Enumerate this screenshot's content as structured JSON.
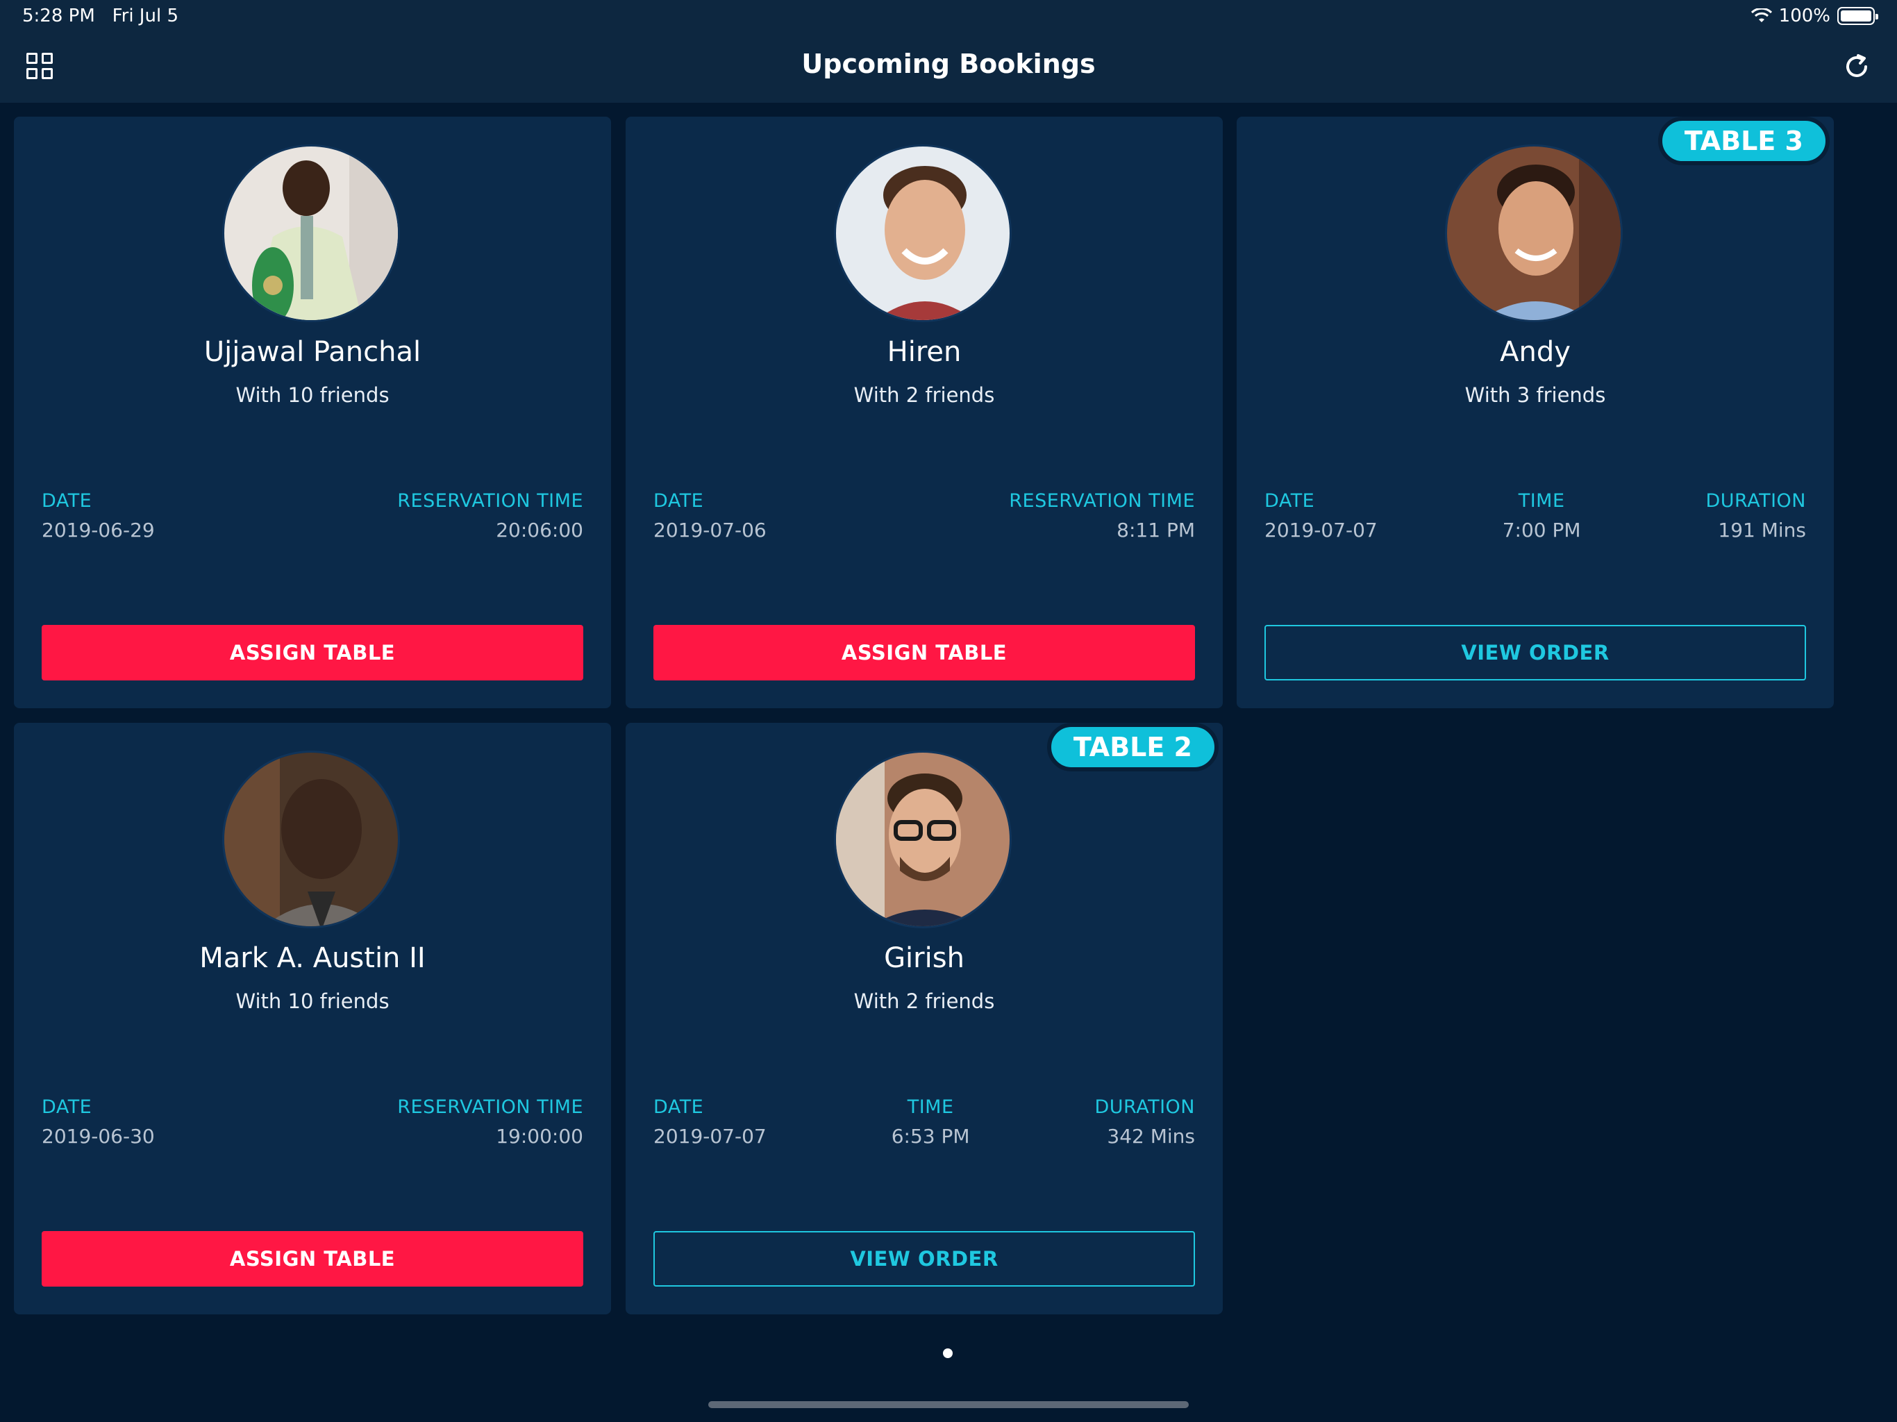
{
  "status_bar": {
    "time": "5:28 PM",
    "date": "Fri Jul 5",
    "battery": "100%"
  },
  "header": {
    "title": "Upcoming Bookings"
  },
  "colors": {
    "background": "#03182f",
    "card": "#0b2a4a",
    "accent": "#1fc8e0",
    "primary_button": "#ff1744"
  },
  "bookings": [
    {
      "name": "Ujjawal Panchal",
      "friends": "With 10 friends",
      "date_label": "DATE",
      "date": "2019-06-29",
      "time_label": "RESERVATION TIME",
      "time": "20:06:00",
      "button": "ASSIGN TABLE"
    },
    {
      "name": "Hiren",
      "friends": "With 2 friends",
      "date_label": "DATE",
      "date": "2019-07-06",
      "time_label": "RESERVATION TIME",
      "time": "8:11 PM",
      "button": "ASSIGN TABLE"
    },
    {
      "name": "Andy",
      "friends": "With 3 friends",
      "badge": "TABLE 3",
      "date_label": "DATE",
      "date": "2019-07-07",
      "time_label": "TIME",
      "time": "7:00 PM",
      "duration_label": "DURATION",
      "duration": "191 Mins",
      "button": "VIEW ORDER"
    },
    {
      "name": "Mark A. Austin II",
      "friends": "With 10 friends",
      "date_label": "DATE",
      "date": "2019-06-30",
      "time_label": "RESERVATION TIME",
      "time": "19:00:00",
      "button": "ASSIGN TABLE"
    },
    {
      "name": "Girish",
      "friends": "With 2 friends",
      "badge": "TABLE 2",
      "date_label": "DATE",
      "date": "2019-07-07",
      "time_label": "TIME",
      "time": "6:53 PM",
      "duration_label": "DURATION",
      "duration": "342 Mins",
      "button": "VIEW ORDER"
    }
  ]
}
